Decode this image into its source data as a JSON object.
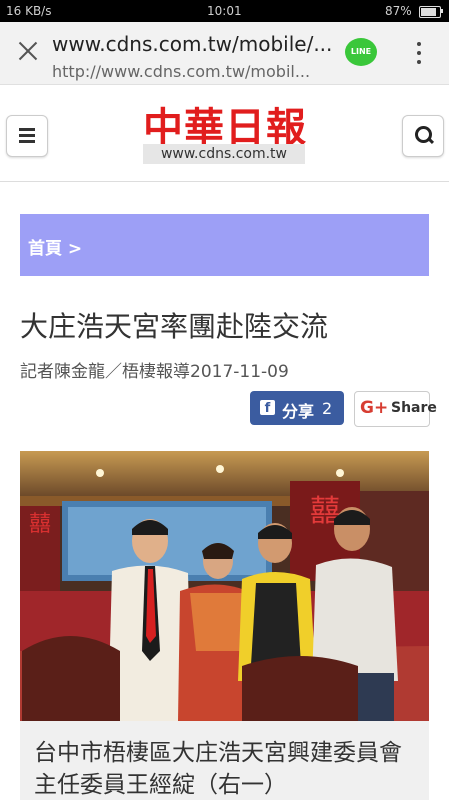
{
  "status_bar": {
    "network_speed": "16 KB/s",
    "time": "10:01",
    "battery": "87%"
  },
  "browser": {
    "url_title": "www.cdns.com.tw/mobile/...",
    "url_full": "http://www.cdns.com.tw/mobil...",
    "line_label": "LINE"
  },
  "site": {
    "logo_text": "中華日報",
    "logo_url": "www.cdns.com.tw"
  },
  "breadcrumb": {
    "home": "首頁 >"
  },
  "article": {
    "title": "大庄浩天宮率團赴陸交流",
    "byline": "記者陳金龍／梧棲報導2017-11-09",
    "caption": "台中市梧棲區大庄浩天宮興建委員會主任委員王經綻（右一）"
  },
  "share": {
    "fb_icon": "f",
    "fb_label": "分享",
    "fb_count": "2",
    "gplus_icon": "G+",
    "gplus_label": "Share"
  },
  "photo_scene": {
    "banner_left": "囍",
    "banner_right": "囍"
  },
  "colors": {
    "breadcrumb_bg": "#9d9ff6",
    "logo_red": "#e11d1d",
    "facebook_blue": "#3b5ca0",
    "gplus_red": "#d73d32"
  }
}
